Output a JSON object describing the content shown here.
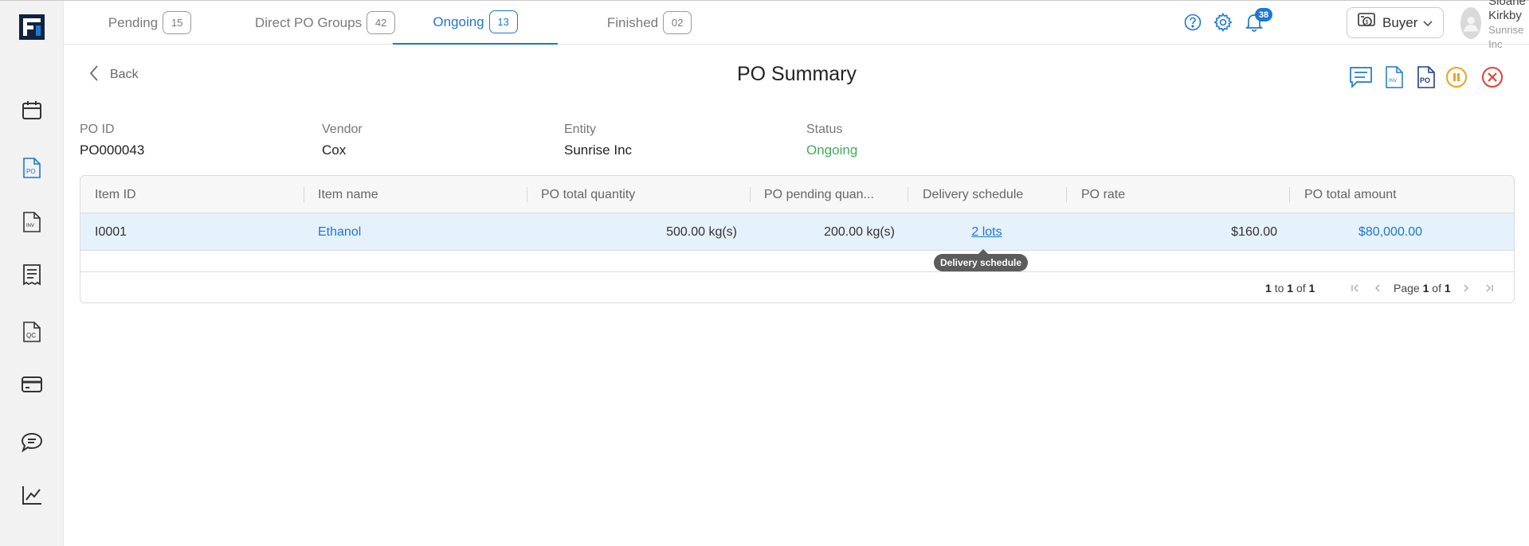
{
  "sidebar": {
    "logo_icon": "fl-logo-icon",
    "items": [
      {
        "icon": "calendar-icon"
      },
      {
        "icon": "po-document-icon",
        "label": "PO",
        "active": true
      },
      {
        "icon": "invoice-document-icon",
        "label": "INV"
      },
      {
        "icon": "receipt-icon"
      },
      {
        "icon": "qc-document-icon",
        "label": "QC"
      },
      {
        "icon": "card-icon"
      },
      {
        "icon": "chat-icon"
      },
      {
        "icon": "analytics-chart-icon"
      }
    ]
  },
  "tabs": [
    {
      "label": "Pending",
      "count": "15"
    },
    {
      "label": "Direct PO Groups",
      "count": "42"
    },
    {
      "label": "Ongoing",
      "count": "13",
      "active": true
    },
    {
      "label": "Finished",
      "count": "02"
    }
  ],
  "topbar": {
    "help_icon": "help-icon",
    "settings_icon": "gear-icon",
    "notification_count": "38",
    "role": "Buyer",
    "user_name": "Sloane Kirkby",
    "user_org": "Sunrise Inc"
  },
  "page": {
    "back_label": "Back",
    "title": "PO Summary",
    "actions": [
      "comments-icon",
      "invoice-icon",
      "po-icon",
      "pause-icon",
      "close-icon"
    ]
  },
  "summary": {
    "po_id_label": "PO ID",
    "po_id": "PO000043",
    "vendor_label": "Vendor",
    "vendor": "Cox",
    "entity_label": "Entity",
    "entity": "Sunrise Inc",
    "status_label": "Status",
    "status": "Ongoing"
  },
  "table": {
    "columns": [
      "Item ID",
      "Item name",
      "PO total quantity",
      "PO pending quan...",
      "Delivery schedule",
      "PO rate",
      "PO total amount"
    ],
    "rows": [
      {
        "item_id": "I0001",
        "item_name": "Ethanol",
        "total_qty": "500.00 kg(s)",
        "pending_qty": "200.00 kg(s)",
        "delivery_schedule": "2 lots",
        "rate": "$160.00",
        "amount": "$80,000.00"
      }
    ],
    "footer": {
      "from": "1",
      "to_word": "to",
      "to": "1",
      "of_word": "of",
      "total": "1",
      "page_word": "Page",
      "page": "1",
      "page_of": "of",
      "pages": "1"
    },
    "tooltip": "Delivery schedule"
  },
  "colors": {
    "accent": "#1d78d1",
    "status_ongoing": "#3fae5a",
    "selected_row": "#e5f1fb",
    "pause": "#f0a21c",
    "close": "#e0413a"
  }
}
